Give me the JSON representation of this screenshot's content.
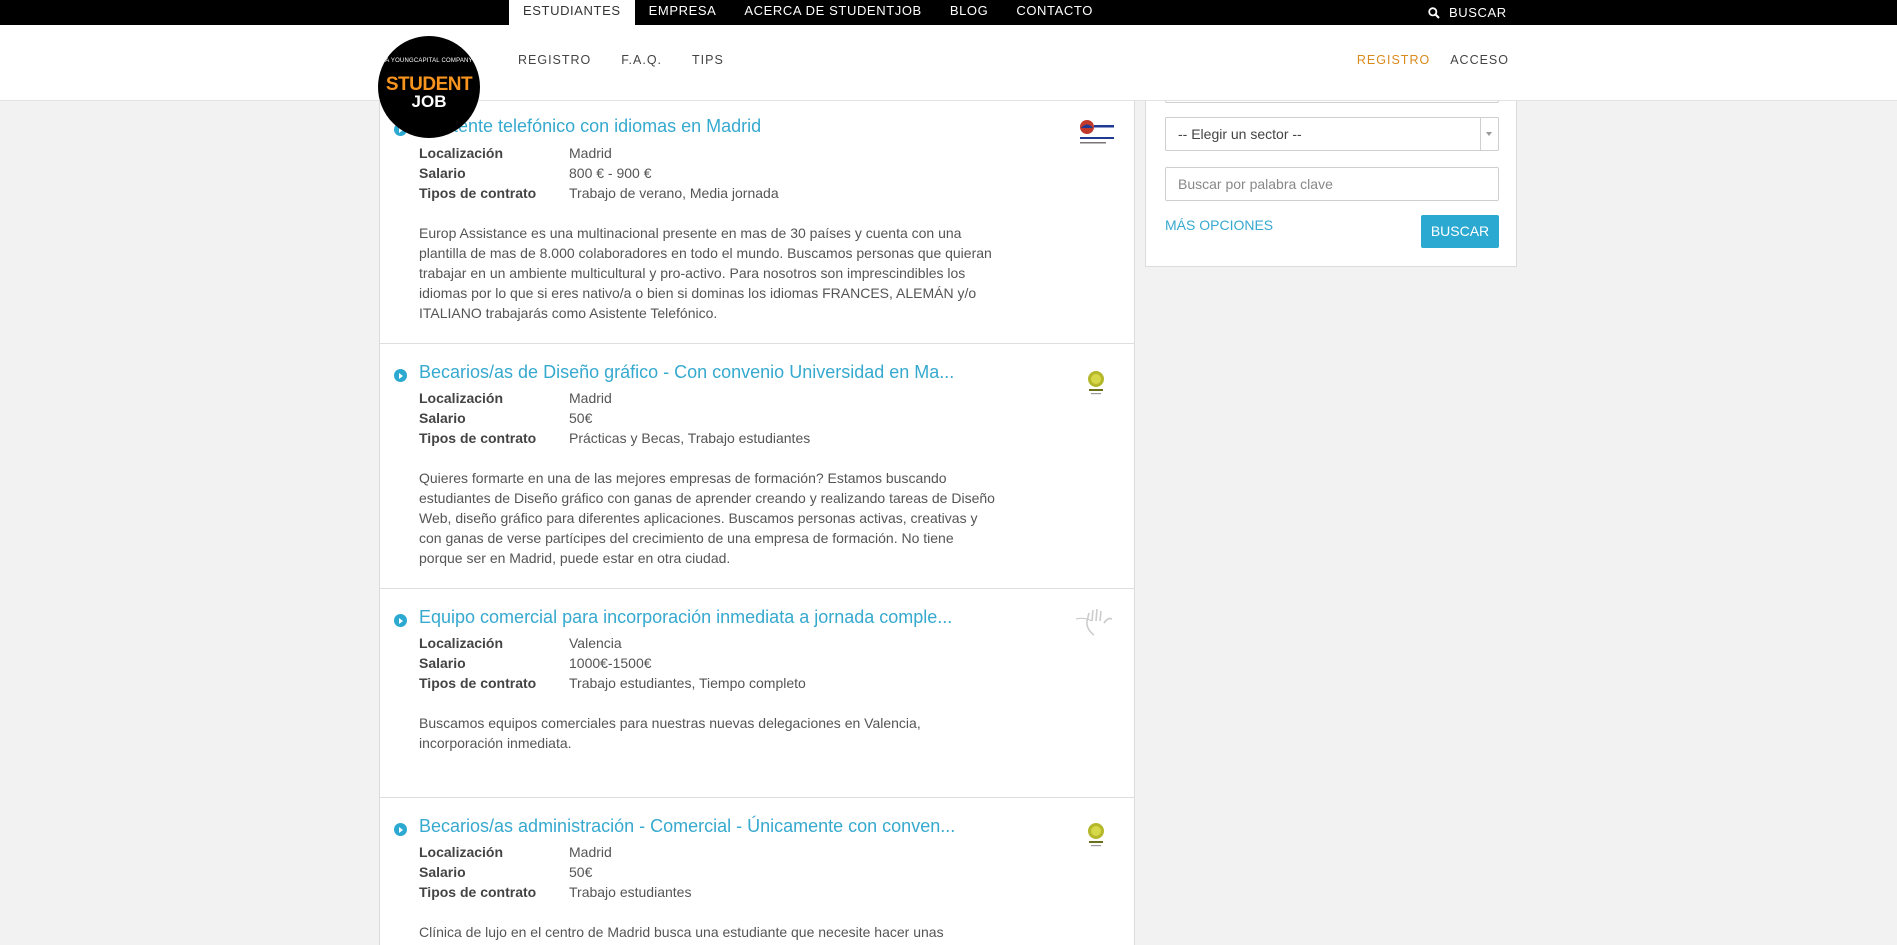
{
  "top_nav": {
    "tabs": [
      "ESTUDIANTES",
      "EMPRESA",
      "ACERCA DE STUDENTJOB",
      "BLOG",
      "CONTACTO"
    ],
    "search_label": "BUSCAR"
  },
  "logo": {
    "tagline": "A YOUNGCAPITAL COMPANY",
    "line1": "STUDENT",
    "line2": "JOB"
  },
  "sub_nav": [
    "REGISTRO",
    "F.A.Q.",
    "TIPS"
  ],
  "account": {
    "register": "REGISTRO",
    "login": "ACCESO"
  },
  "labels": {
    "location": "Localización",
    "salary": "Salario",
    "contract": "Tipos de contrato"
  },
  "jobs": [
    {
      "title": "Asistente telefónico con idiomas en Madrid",
      "location": "Madrid",
      "salary": "800 € - 900 €",
      "contract": "Trabajo de verano, Media jornada",
      "description": "Europ Assistance es una multinacional presente en mas de 30 países y cuenta con una plantilla de mas de 8.000 colaboradores en todo el mundo. Buscamos personas que quieran trabajar en un ambiente multicultural y pro-activo. Para nosotros son imprescindibles los idiomas por lo que si eres nativo/a o bien si dominas los idiomas FRANCES, ALEMÁN y/o ITALIANO trabajarás como Asistente Telefónico.",
      "logo_icon": "europ-assistance-logo"
    },
    {
      "title": "Becarios/as de Diseño gráfico - Con convenio Universidad en Ma...",
      "location": "Madrid",
      "salary": "50€",
      "contract": "Prácticas y Becas, Trabajo estudiantes",
      "description": "Quieres formarte en una de las mejores empresas de formación? Estamos buscando estudiantes de Diseño gráfico con ganas de aprender creando y realizando tareas de Diseño Web, diseño gráfico para diferentes aplicaciones. Buscamos personas activas, creativas y con ganas de verse partícipes del crecimiento de una empresa de formación. No tiene porque ser en Madrid, puede estar en otra ciudad.",
      "logo_icon": "lobe-logo"
    },
    {
      "title": "Equipo comercial para incorporación inmediata a jornada comple...",
      "location": "Valencia",
      "salary": "1000€-1500€",
      "contract": "Trabajo estudiantes, Tiempo completo",
      "description": "Buscamos equipos comerciales para nuestras nuevas delegaciones en Valencia, incorporación inmediata.",
      "logo_icon": "hand-logo"
    },
    {
      "title": "Becarios/as administración - Comercial - Únicamente con conven...",
      "location": "Madrid",
      "salary": "50€",
      "contract": "Trabajo estudiantes",
      "description": "Clínica de lujo en el centro de Madrid busca una estudiante que necesite hacer unas",
      "logo_icon": "lobe-logo"
    }
  ],
  "sidebar": {
    "sector_select": "-- Elegir un sector --",
    "keyword_placeholder": "Buscar por palabra clave",
    "more_options": "MÁS OPCIONES",
    "search_button": "BUSCAR"
  },
  "colors": {
    "accent_blue": "#2ba9d1",
    "brand_orange": "#f7941d",
    "register_orange": "#d98a1c"
  }
}
